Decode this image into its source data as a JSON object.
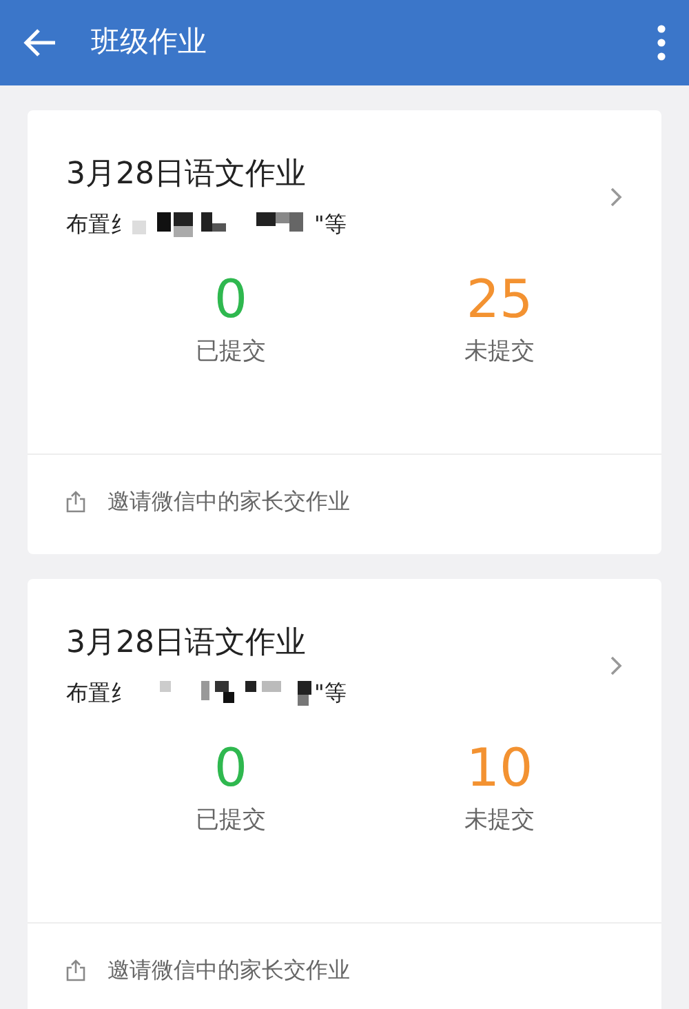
{
  "app_bar": {
    "title": "班级作业"
  },
  "assignments": [
    {
      "title": "3月28日语文作业",
      "assigned_prefix": "布置纟",
      "assigned_suffix": "\"等",
      "stats": [
        {
          "value": "0",
          "label": "已提交",
          "color": "#2fb84f"
        },
        {
          "value": "25",
          "label": "未提交",
          "color": "#f39231"
        }
      ],
      "invite": "邀请微信中的家长交作业"
    },
    {
      "title": "3月28日语文作业",
      "assigned_prefix": "布置纟",
      "assigned_suffix": "\"等",
      "stats": [
        {
          "value": "0",
          "label": "已提交",
          "color": "#2fb84f"
        },
        {
          "value": "10",
          "label": "未提交",
          "color": "#f39231"
        }
      ],
      "invite": "邀请微信中的家长交作业"
    }
  ]
}
